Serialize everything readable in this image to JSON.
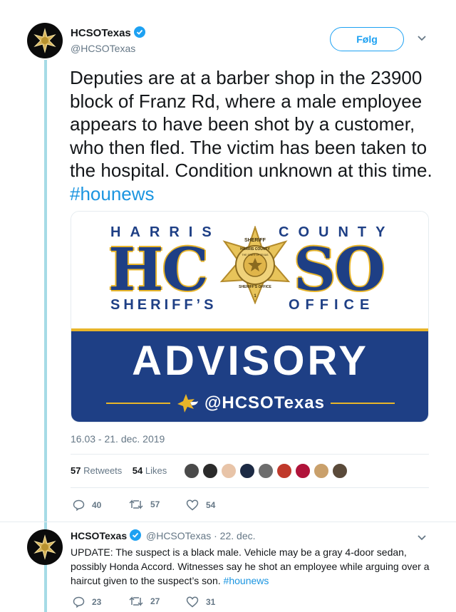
{
  "main_tweet": {
    "display_name": "HCSOTexas",
    "handle": "@HCSOTexas",
    "follow_label": "Følg",
    "text": "Deputies are at a barber shop in the 23900 block of Franz Rd, where a male employee appears to have been shot by a customer, who then fled. The victim has been taken to the hospital. Condition unknown at this time. ",
    "hashtag": "#hounews",
    "card": {
      "harris": "HARRIS",
      "county": "COUNTY",
      "hc": "HC",
      "so": "SO",
      "sheriffs": "SHERIFF’S",
      "office": "OFFICE",
      "badge_top": "SHERIFF",
      "badge_ring": "HARRIS COUNTY",
      "badge_bottom": "SHERIFF'S OFFICE",
      "badge_center": "THE STATE OF TEXAS",
      "badge_number": "1",
      "advisory": "ADVISORY",
      "handle": "@HCSOTexas"
    },
    "timestamp": "16.03 - 21. dec. 2019",
    "retweets_count": "57",
    "retweets_label": "Retweets",
    "likes_count": "54",
    "likes_label": "Likes",
    "actions": {
      "replies": "40",
      "retweets": "57",
      "likes": "54"
    }
  },
  "likers": [
    "#4a4a4a",
    "#2b2b2b",
    "#e8c4a8",
    "#1c2a44",
    "#6d6d6d",
    "#c0392b",
    "#b0133a",
    "#c9a06b",
    "#5a4a3a"
  ],
  "reply_tweet": {
    "display_name": "HCSOTexas",
    "handle": "@HCSOTexas",
    "date": "· 22. dec.",
    "text": "UPDATE: The suspect is a black male. Vehicle may be a gray 4-door sedan, possibly Honda Accord. Witnesses say he shot an employee while arguing over a haircut given to the suspect’s son. ",
    "hashtag": "#hounews",
    "actions": {
      "replies": "23",
      "retweets": "27",
      "likes": "31"
    }
  },
  "colors": {
    "link": "#1b95e0",
    "navy": "#1e3f85",
    "gold": "#e8b52a",
    "thread": "#a6dbe6"
  }
}
